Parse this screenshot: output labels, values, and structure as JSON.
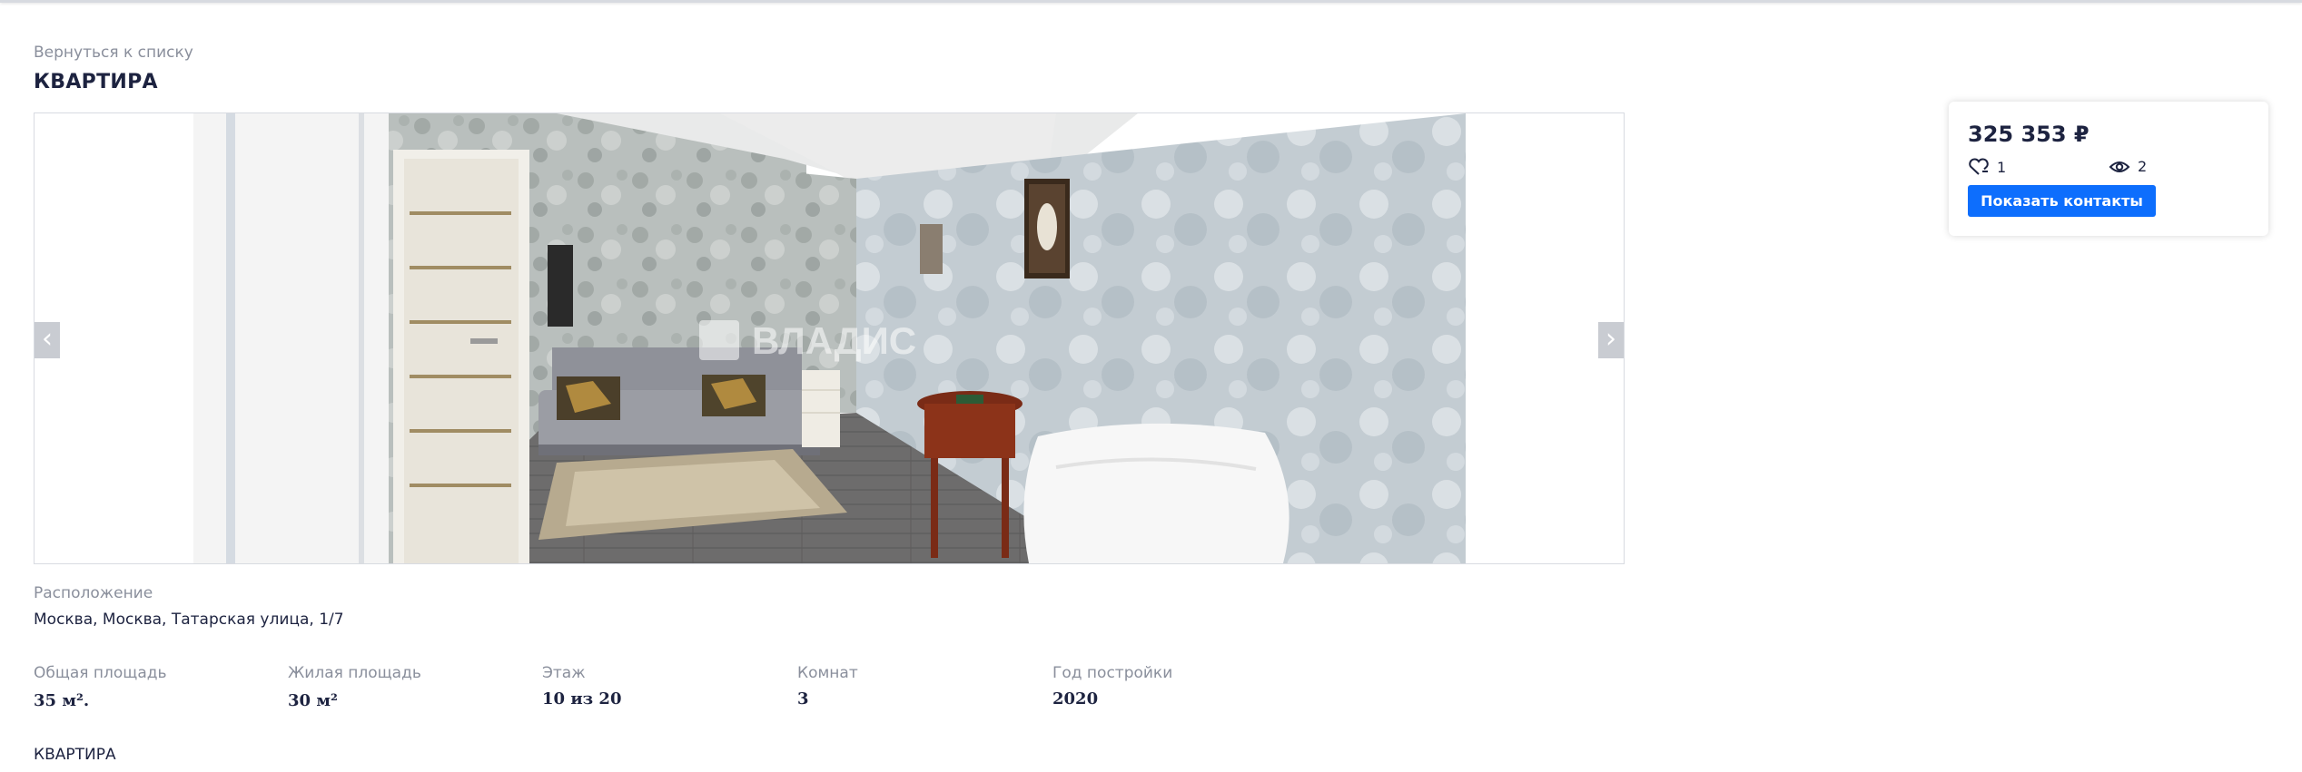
{
  "header": {
    "back_link": "Вернуться к списку",
    "title": "КВАРТИРА"
  },
  "gallery": {
    "prev_symbol": "‹",
    "next_symbol": "›",
    "watermark": "ВЛАДИС"
  },
  "location": {
    "label": "Расположение",
    "address": "Москва, Москва, Татарская улица, 1/7"
  },
  "params": [
    {
      "label": "Общая площадь",
      "value": "35 м²."
    },
    {
      "label": "Жилая площадь",
      "value": "30 м²"
    },
    {
      "label": "Этаж",
      "value": "10 из 20"
    },
    {
      "label": "Комнат",
      "value": "3"
    },
    {
      "label": "Год постройки",
      "value": "2020"
    }
  ],
  "footer": {
    "type_label": "КВАРТИРА"
  },
  "price_card": {
    "price": "325 353 ₽",
    "favorites_count": "1",
    "views_count": "2",
    "contacts_button": "Показать контакты",
    "favorites_icon": "heart-icon",
    "views_icon": "eye-icon",
    "button_color": "#0d6efd"
  }
}
